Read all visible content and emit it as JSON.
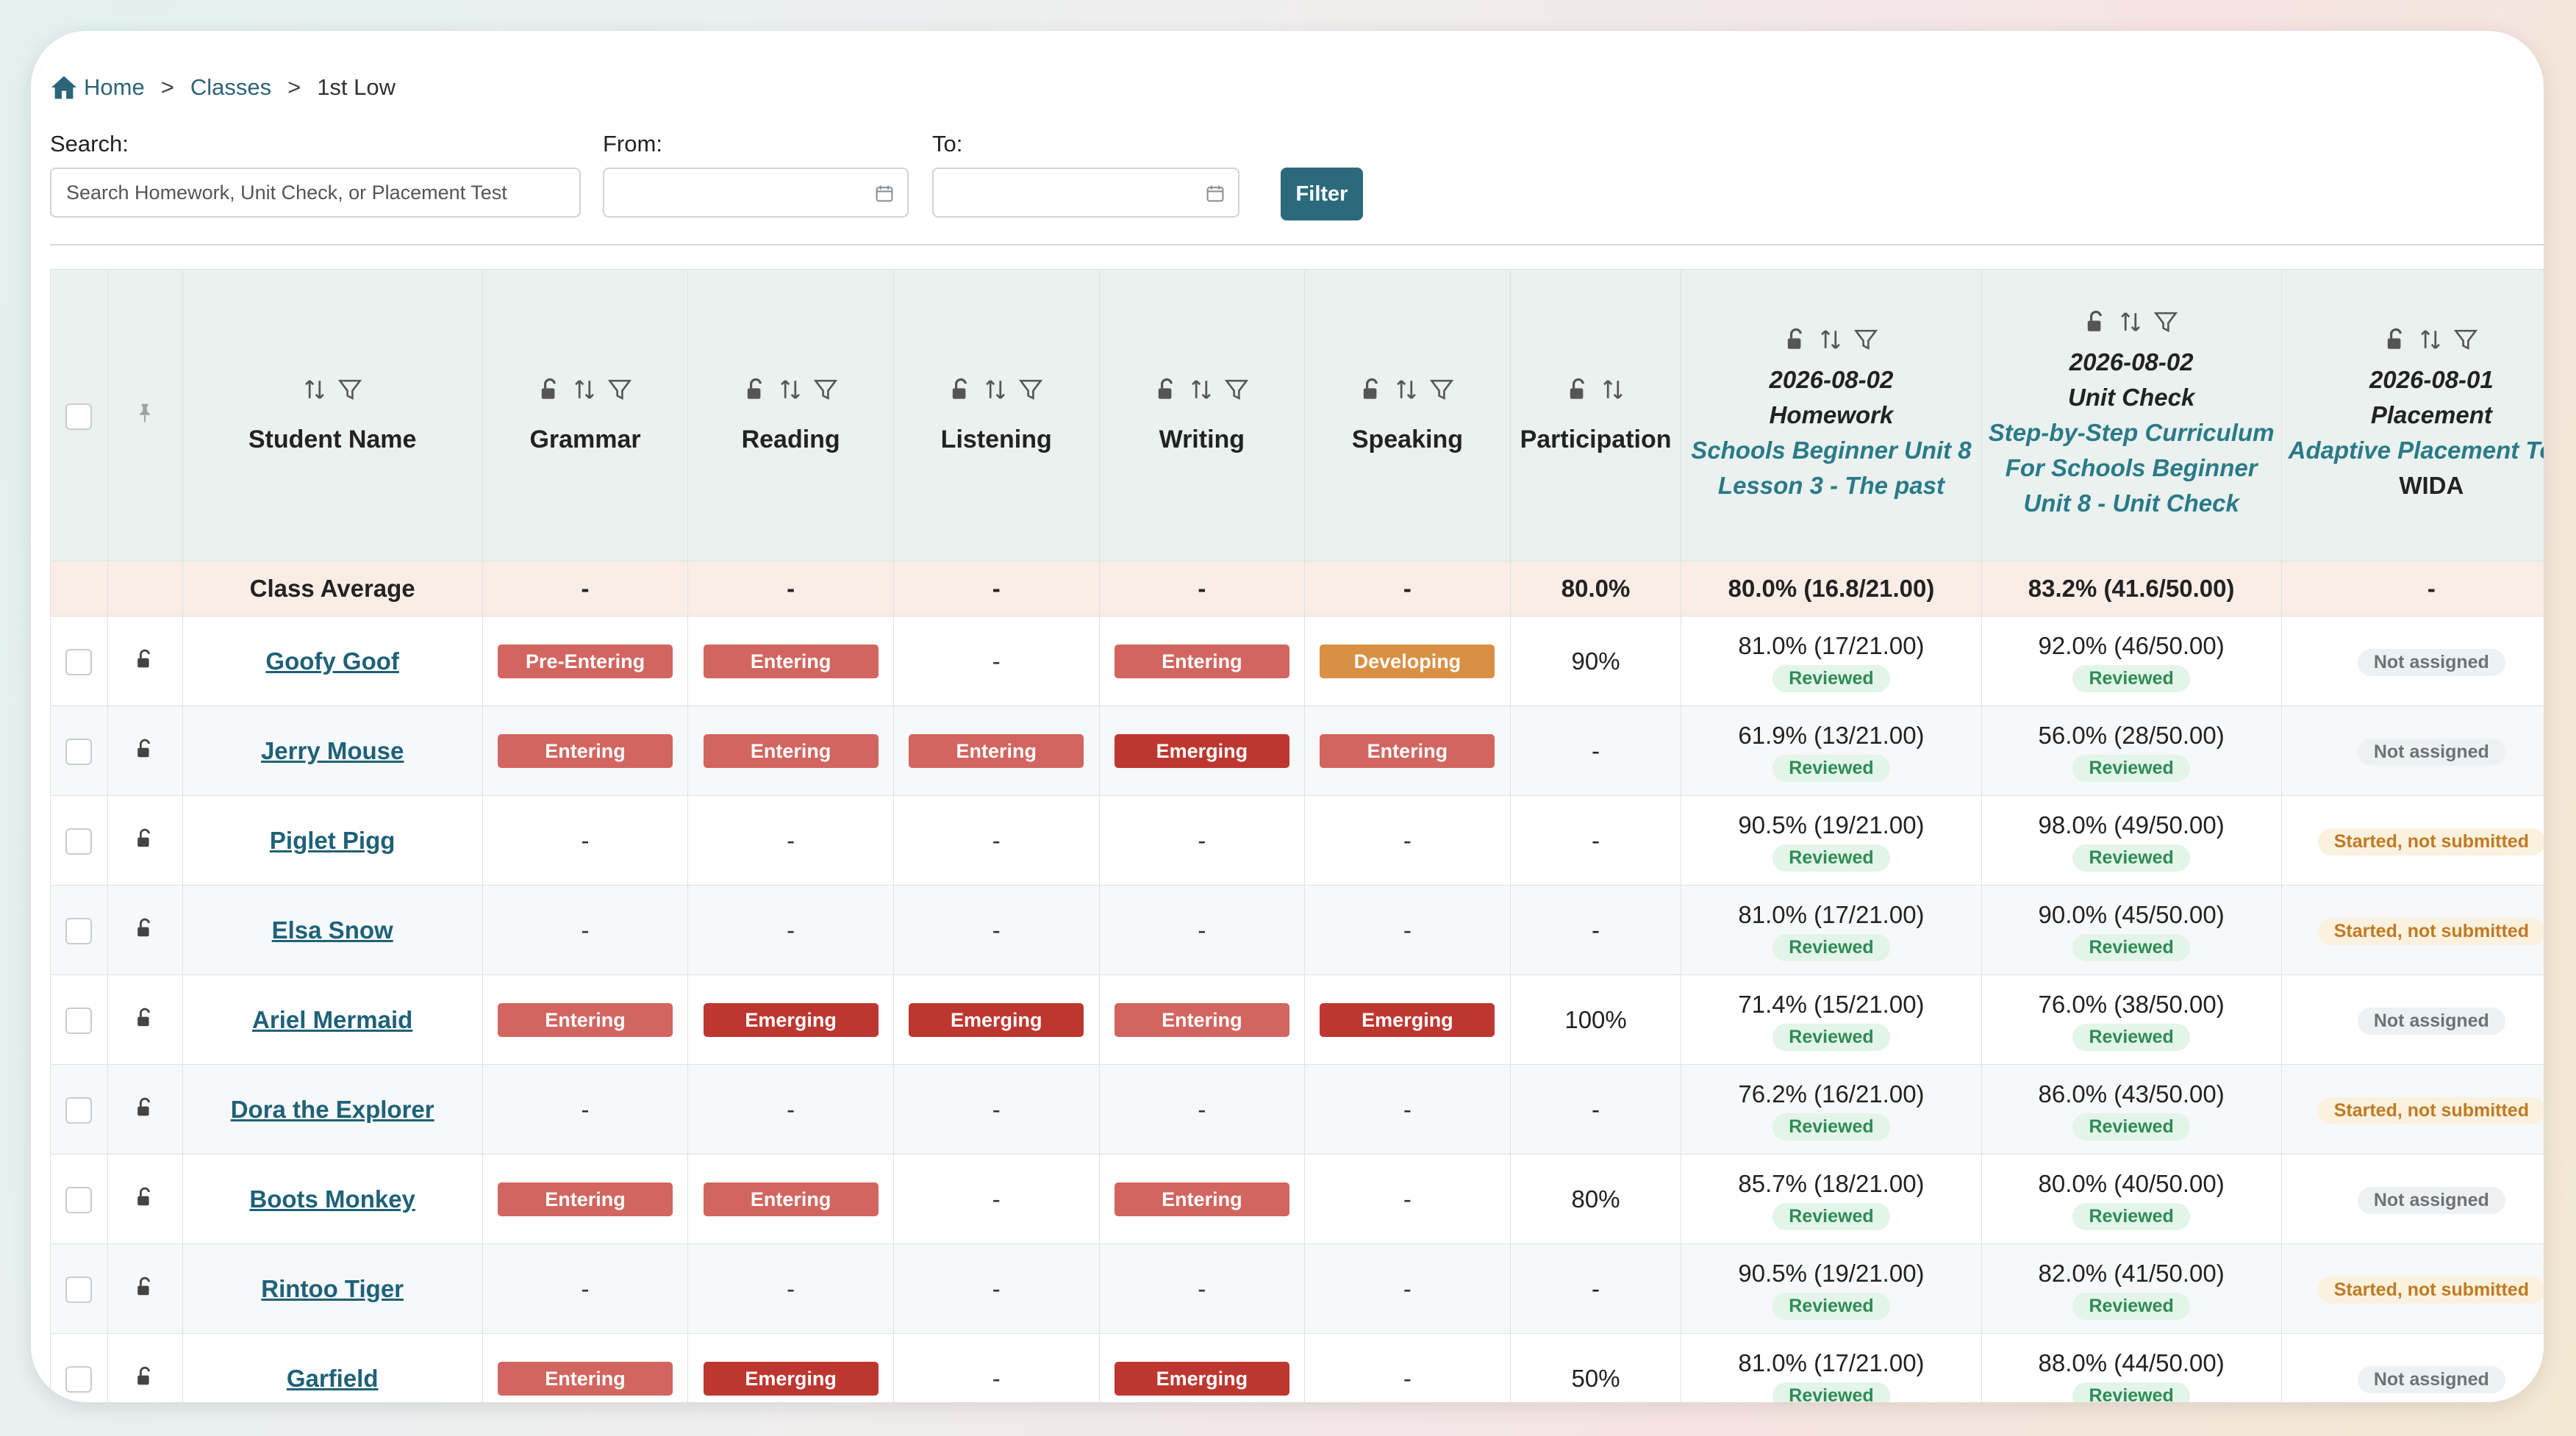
{
  "breadcrumb": {
    "home": "Home",
    "classes": "Classes",
    "current": "1st Low",
    "separator": ">"
  },
  "filters": {
    "search_label": "Search:",
    "search_placeholder": "Search Homework, Unit Check, or Placement Test",
    "from_label": "From:",
    "to_label": "To:",
    "filter_button": "Filter"
  },
  "columns": {
    "student_name": "Student Name",
    "grammar": "Grammar",
    "reading": "Reading",
    "listening": "Listening",
    "writing": "Writing",
    "speaking": "Speaking",
    "participation": "Participation",
    "homework": {
      "date": "2026-08-02",
      "type": "Homework",
      "name": "Schools Beginner Unit 8 Lesson 3 - The past"
    },
    "unit_check": {
      "date": "2026-08-02",
      "type": "Unit Check",
      "name": "Step-by-Step Curriculum For Schools Beginner Unit 8 - Unit Check"
    },
    "placement": {
      "date": "2026-08-01",
      "type": "Placement",
      "name": "Adaptive Placement Test",
      "sub": "WIDA"
    }
  },
  "class_average": {
    "label": "Class Average",
    "grammar": "-",
    "reading": "-",
    "listening": "-",
    "writing": "-",
    "speaking": "-",
    "participation": "80.0%",
    "homework": "80.0% (16.8/21.00)",
    "unit_check": "83.2% (41.6/50.00)",
    "placement": "-"
  },
  "students": [
    {
      "name": "Goofy Goof",
      "grammar": "Pre-Entering",
      "reading": "Entering",
      "listening": "-",
      "writing": "Entering",
      "speaking": "Developing",
      "participation": "90%",
      "homework": "81.0% (17/21.00)",
      "homework_status": "Reviewed",
      "unit_check": "92.0% (46/50.00)",
      "unit_check_status": "Reviewed",
      "placement": "Not assigned"
    },
    {
      "name": "Jerry Mouse",
      "grammar": "Entering",
      "reading": "Entering",
      "listening": "Entering",
      "writing": "Emerging",
      "speaking": "Entering",
      "participation": "-",
      "homework": "61.9% (13/21.00)",
      "homework_status": "Reviewed",
      "unit_check": "56.0% (28/50.00)",
      "unit_check_status": "Reviewed",
      "placement": "Not assigned"
    },
    {
      "name": "Piglet Pigg",
      "grammar": "-",
      "reading": "-",
      "listening": "-",
      "writing": "-",
      "speaking": "-",
      "participation": "-",
      "homework": "90.5% (19/21.00)",
      "homework_status": "Reviewed",
      "unit_check": "98.0% (49/50.00)",
      "unit_check_status": "Reviewed",
      "placement": "Started, not submitted"
    },
    {
      "name": "Elsa Snow",
      "grammar": "-",
      "reading": "-",
      "listening": "-",
      "writing": "-",
      "speaking": "-",
      "participation": "-",
      "homework": "81.0% (17/21.00)",
      "homework_status": "Reviewed",
      "unit_check": "90.0% (45/50.00)",
      "unit_check_status": "Reviewed",
      "placement": "Started, not submitted"
    },
    {
      "name": "Ariel Mermaid",
      "grammar": "Entering",
      "reading": "Emerging",
      "listening": "Emerging",
      "writing": "Entering",
      "speaking": "Emerging",
      "participation": "100%",
      "homework": "71.4% (15/21.00)",
      "homework_status": "Reviewed",
      "unit_check": "76.0% (38/50.00)",
      "unit_check_status": "Reviewed",
      "placement": "Not assigned"
    },
    {
      "name": "Dora the Explorer",
      "grammar": "-",
      "reading": "-",
      "listening": "-",
      "writing": "-",
      "speaking": "-",
      "participation": "-",
      "homework": "76.2% (16/21.00)",
      "homework_status": "Reviewed",
      "unit_check": "86.0% (43/50.00)",
      "unit_check_status": "Reviewed",
      "placement": "Started, not submitted"
    },
    {
      "name": "Boots Monkey",
      "grammar": "Entering",
      "reading": "Entering",
      "listening": "-",
      "writing": "Entering",
      "speaking": "-",
      "participation": "80%",
      "homework": "85.7% (18/21.00)",
      "homework_status": "Reviewed",
      "unit_check": "80.0% (40/50.00)",
      "unit_check_status": "Reviewed",
      "placement": "Not assigned"
    },
    {
      "name": "Rintoo Tiger",
      "grammar": "-",
      "reading": "-",
      "listening": "-",
      "writing": "-",
      "speaking": "-",
      "participation": "-",
      "homework": "90.5% (19/21.00)",
      "homework_status": "Reviewed",
      "unit_check": "82.0% (41/50.00)",
      "unit_check_status": "Reviewed",
      "placement": "Started, not submitted"
    },
    {
      "name": "Garfield",
      "grammar": "Entering",
      "reading": "Emerging",
      "listening": "-",
      "writing": "Emerging",
      "speaking": "-",
      "participation": "50%",
      "homework": "81.0% (17/21.00)",
      "homework_status": "Reviewed",
      "unit_check": "88.0% (44/50.00)",
      "unit_check_status": "Reviewed",
      "placement": "Not assigned"
    }
  ],
  "colors": {
    "primary": "#2b6a7d",
    "entering": "#d2655f",
    "emerging": "#bd3730",
    "developing": "#d99044",
    "reviewed": "#2e8b55",
    "started": "#c07a21",
    "header_bg": "#eaf1ef",
    "average_bg": "#f9ede6"
  },
  "icons": [
    "home-icon",
    "calendar-icon",
    "sort-icon",
    "filter-icon",
    "lock-open-icon",
    "pin-icon"
  ]
}
